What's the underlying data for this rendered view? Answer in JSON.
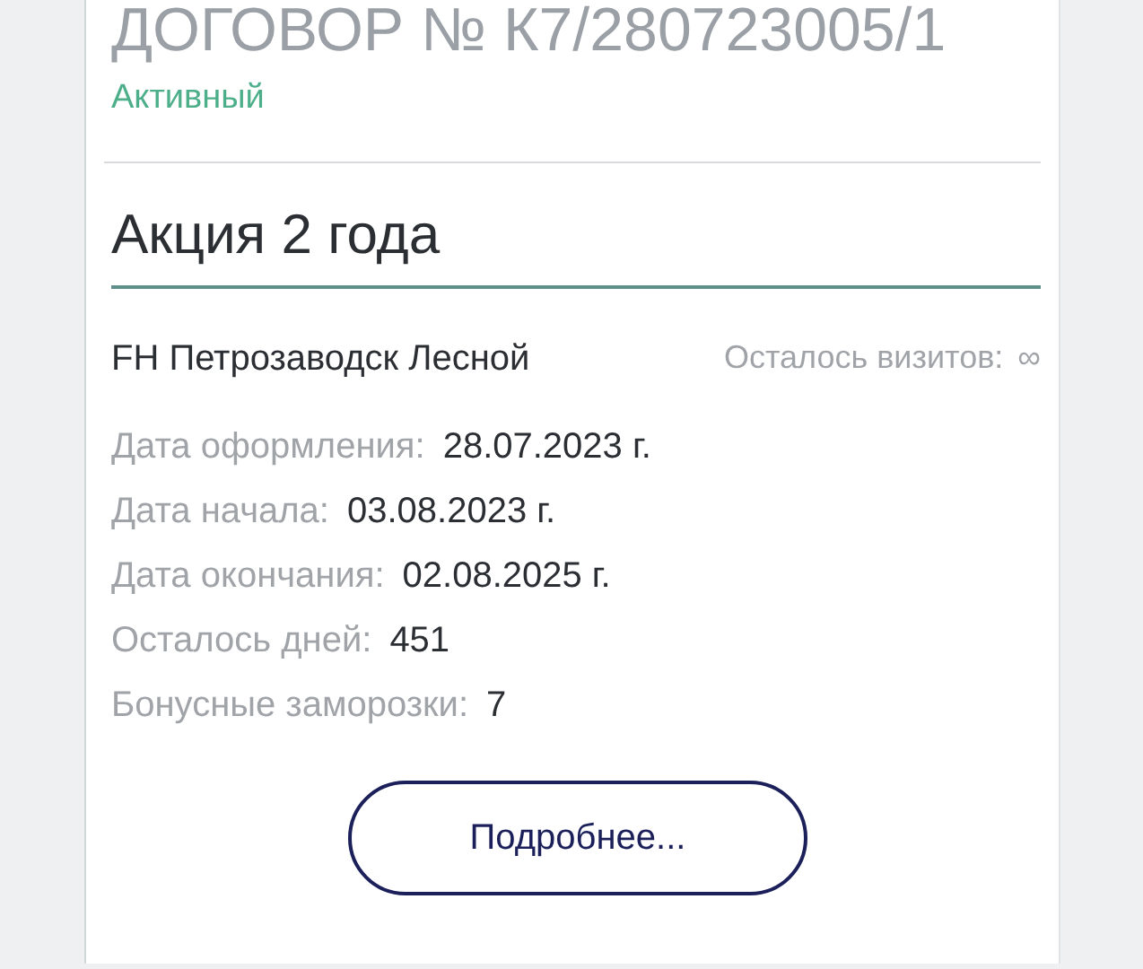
{
  "contract": {
    "number": "ДОГОВОР № К7/280723005/1",
    "status": "Активный",
    "active": true
  },
  "plan": {
    "title": "Акция 2 года",
    "club": "FH Петрозаводск Лесной",
    "visits_label": "Осталось визитов:",
    "visits_value": "∞"
  },
  "details": [
    {
      "label": "Дата оформления:",
      "value": "28.07.2023 г."
    },
    {
      "label": "Дата начала:",
      "value": "03.08.2023 г."
    },
    {
      "label": "Дата окончания:",
      "value": "02.08.2025 г."
    },
    {
      "label": "Осталось дней:",
      "value": "451"
    },
    {
      "label": "Бонусные заморозки:",
      "value": "7"
    }
  ],
  "button": "Подробнее..."
}
